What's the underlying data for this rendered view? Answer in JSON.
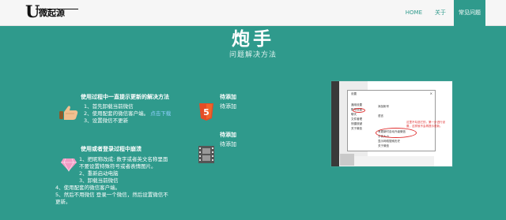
{
  "nav": {
    "logo_mark": "U",
    "logo_name": "微起源",
    "items": [
      {
        "label": "HOME",
        "active": false
      },
      {
        "label": "关于",
        "active": false
      },
      {
        "label": "常见问题",
        "active": true
      }
    ]
  },
  "header": {
    "title": "炮手",
    "subtitle": "问题解决方法"
  },
  "section1": {
    "title": "使用过程中一直提示更新的解决方法",
    "icon": "thumbs-up-icon",
    "steps": [
      "1、首先卸载当前微信",
      "2、使用配套的微信客户端。",
      "3、设置微信不更新"
    ],
    "link": "点击下载"
  },
  "section2": {
    "title": "使用或者登录过程中崩溃",
    "icon": "diamond-icon",
    "steps": [
      "1、把昵称改成: 数字或者英文名称里面",
      "不要设置特殊符号或者表情图片。",
      "2、重新启动电脑",
      "3、卸载当前微信",
      "4、使用配套的微信客户端。",
      "5、然后不用微信 登录一个微信，然后设置微信不",
      "更新。"
    ]
  },
  "column2": {
    "item1_title": "待添加",
    "item1_text": "待添加",
    "item1_icon": "html5-icon",
    "item2_title": "待添加",
    "item2_text": "待添加",
    "item2_icon": "film-icon"
  },
  "screenshot": {
    "dialog_title": "设置",
    "menu": [
      "通用设置",
      "账号设置",
      "聊天",
      "文件管理",
      "快捷按键",
      "关于微信"
    ],
    "options": [
      "添加帐号",
      "语言",
      "有更新时自动升级微信",
      "字体大小",
      "显示网络搜索历史",
      "关于微信"
    ],
    "note": "这里不勾选它的，第一步进行设置，这样就不会再提示更新。"
  },
  "colors": {
    "accent": "#2f9a8c",
    "navbar": "#f6f6f6",
    "html5": "#e44d26"
  }
}
